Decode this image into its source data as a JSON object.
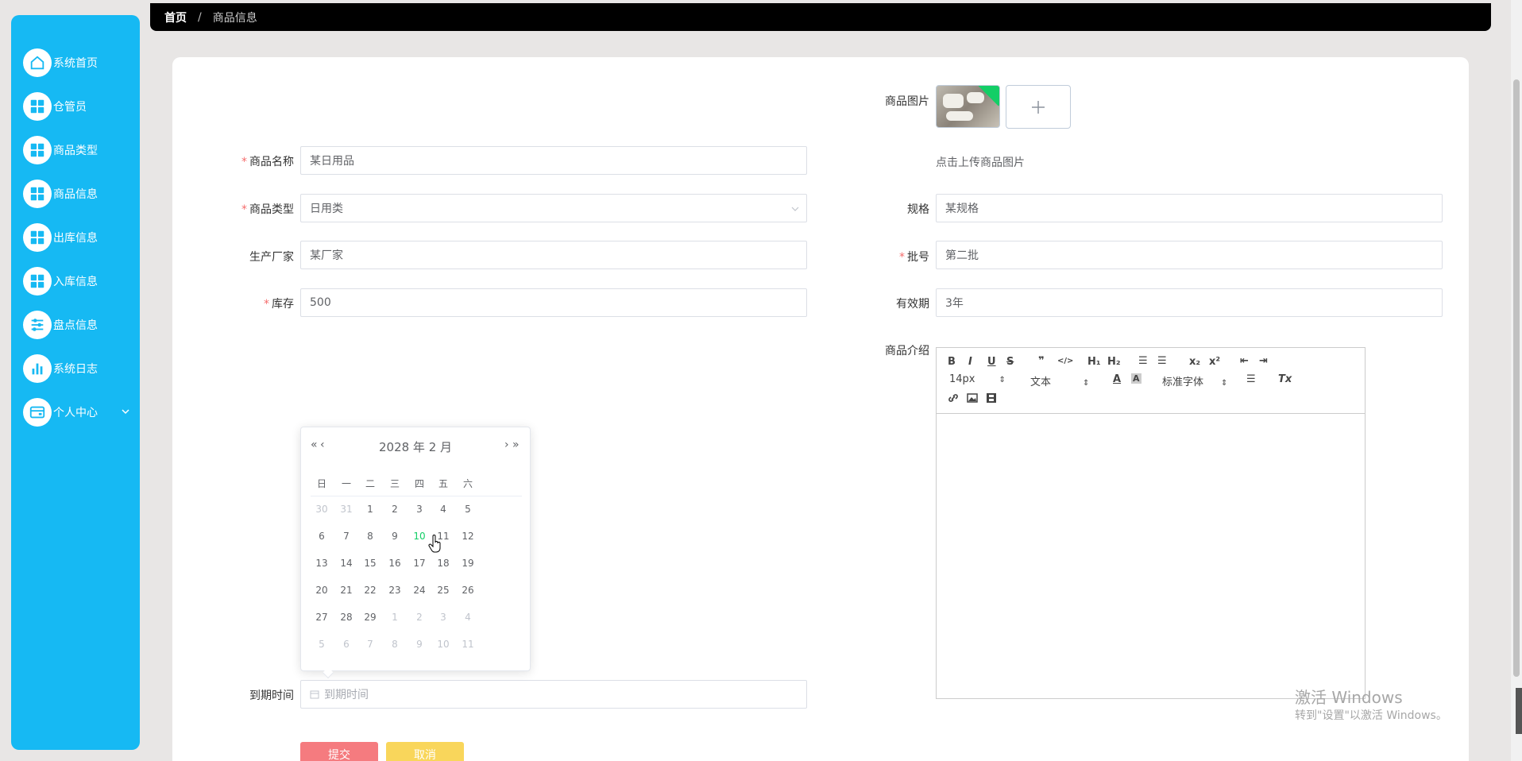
{
  "sidebar": {
    "items": [
      {
        "label": "系统首页",
        "icon": "home-icon"
      },
      {
        "label": "仓管员",
        "icon": "grid-icon"
      },
      {
        "label": "商品类型",
        "icon": "grid-icon"
      },
      {
        "label": "商品信息",
        "icon": "grid-icon"
      },
      {
        "label": "出库信息",
        "icon": "grid-icon"
      },
      {
        "label": "入库信息",
        "icon": "grid-icon"
      },
      {
        "label": "盘点信息",
        "icon": "sliders-icon"
      },
      {
        "label": "系统日志",
        "icon": "bar-chart-icon"
      },
      {
        "label": "个人中心",
        "icon": "card-icon"
      }
    ],
    "accent": "#16b9f3"
  },
  "breadcrumb": {
    "home": "首页",
    "separator": "/",
    "current": "商品信息"
  },
  "form": {
    "name": {
      "label": "商品名称",
      "value": "某日用品",
      "required": true
    },
    "type": {
      "label": "商品类型",
      "value": "日用类",
      "required": true
    },
    "maker": {
      "label": "生产厂家",
      "value": "某厂家"
    },
    "stock": {
      "label": "库存",
      "value": "500",
      "required": true
    },
    "expire": {
      "label": "到期时间",
      "placeholder": "到期时间"
    },
    "image": {
      "label": "商品图片",
      "hint": "点击上传商品图片"
    },
    "spec": {
      "label": "规格",
      "value": "某规格"
    },
    "batch": {
      "label": "批号",
      "value": "第二批",
      "required": true
    },
    "validity": {
      "label": "有效期",
      "value": "3年"
    },
    "intro": {
      "label": "商品介绍"
    },
    "required_mark": "*"
  },
  "editor": {
    "bold": "B",
    "italic": "I",
    "underline": "U",
    "strike": "S",
    "quote": "❞",
    "code": "</>",
    "h1": "H₁",
    "h2": "H₂",
    "ol": "☰",
    "ul": "☰",
    "sub": "x₂",
    "sup": "x²",
    "outdent": "⇤",
    "indent": "⇥",
    "size": "14px",
    "header": "文本",
    "font": "标准字体",
    "color": "A",
    "bg": "A",
    "align": "☰",
    "clean": "Tx"
  },
  "datepicker": {
    "title": "2028 年  2 月",
    "prev_year": "«",
    "prev_month": "‹",
    "next_month": "›",
    "next_year": "»",
    "weekdays": [
      "日",
      "一",
      "二",
      "三",
      "四",
      "五",
      "六"
    ],
    "weeks": [
      [
        "30",
        "31",
        "1",
        "2",
        "3",
        "4",
        "5"
      ],
      [
        "6",
        "7",
        "8",
        "9",
        "10",
        "11",
        "12"
      ],
      [
        "13",
        "14",
        "15",
        "16",
        "17",
        "18",
        "19"
      ],
      [
        "20",
        "21",
        "22",
        "23",
        "24",
        "25",
        "26"
      ],
      [
        "27",
        "28",
        "29",
        "1",
        "2",
        "3",
        "4"
      ],
      [
        "5",
        "6",
        "7",
        "8",
        "9",
        "10",
        "11"
      ]
    ],
    "today": "10"
  },
  "buttons": {
    "submit": "提交",
    "cancel": "取消",
    "submit_color": "#f57b7f",
    "cancel_color": "#f9d65b"
  },
  "watermark": {
    "line1": "激活 Windows",
    "line2": "转到\"设置\"以激活 Windows。"
  }
}
